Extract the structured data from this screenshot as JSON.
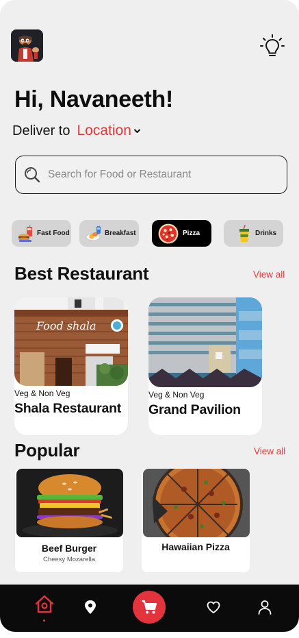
{
  "header": {
    "greeting": "Hi, Navaneeth!",
    "deliver_label": "Deliver to",
    "location": "Location"
  },
  "search": {
    "placeholder": "Search for Food or Restaurant"
  },
  "categories": [
    {
      "label": "Fast Food",
      "icon": "fast-food-icon",
      "active": false
    },
    {
      "label": "Breakfast",
      "icon": "breakfast-icon",
      "active": false
    },
    {
      "label": "Pizza",
      "icon": "pizza-icon",
      "active": true
    },
    {
      "label": "Drinks",
      "icon": "drinks-icon",
      "active": false
    }
  ],
  "best": {
    "title": "Best Restaurant",
    "view_all": "View all",
    "items": [
      {
        "type": "Veg & Non Veg",
        "name": "Shala Restaurant",
        "sign": "Food shala"
      },
      {
        "type": "Veg & Non Veg",
        "name": "Grand Pavilion"
      }
    ]
  },
  "popular": {
    "title": "Popular",
    "view_all": "View all",
    "items": [
      {
        "name": "Beef Burger",
        "sub": "Cheesy Mozarella"
      },
      {
        "name": "Hawaiian Pizza"
      }
    ]
  },
  "colors": {
    "accent": "#e33a3a",
    "background": "#efefef",
    "nav": "#0b0b0b",
    "active_chip": "#000000",
    "chip": "#d4d4d4"
  },
  "nav": {
    "items": [
      "home-icon",
      "location-pin-icon",
      "cart-icon",
      "heart-icon",
      "profile-icon"
    ],
    "active": "home-icon"
  }
}
